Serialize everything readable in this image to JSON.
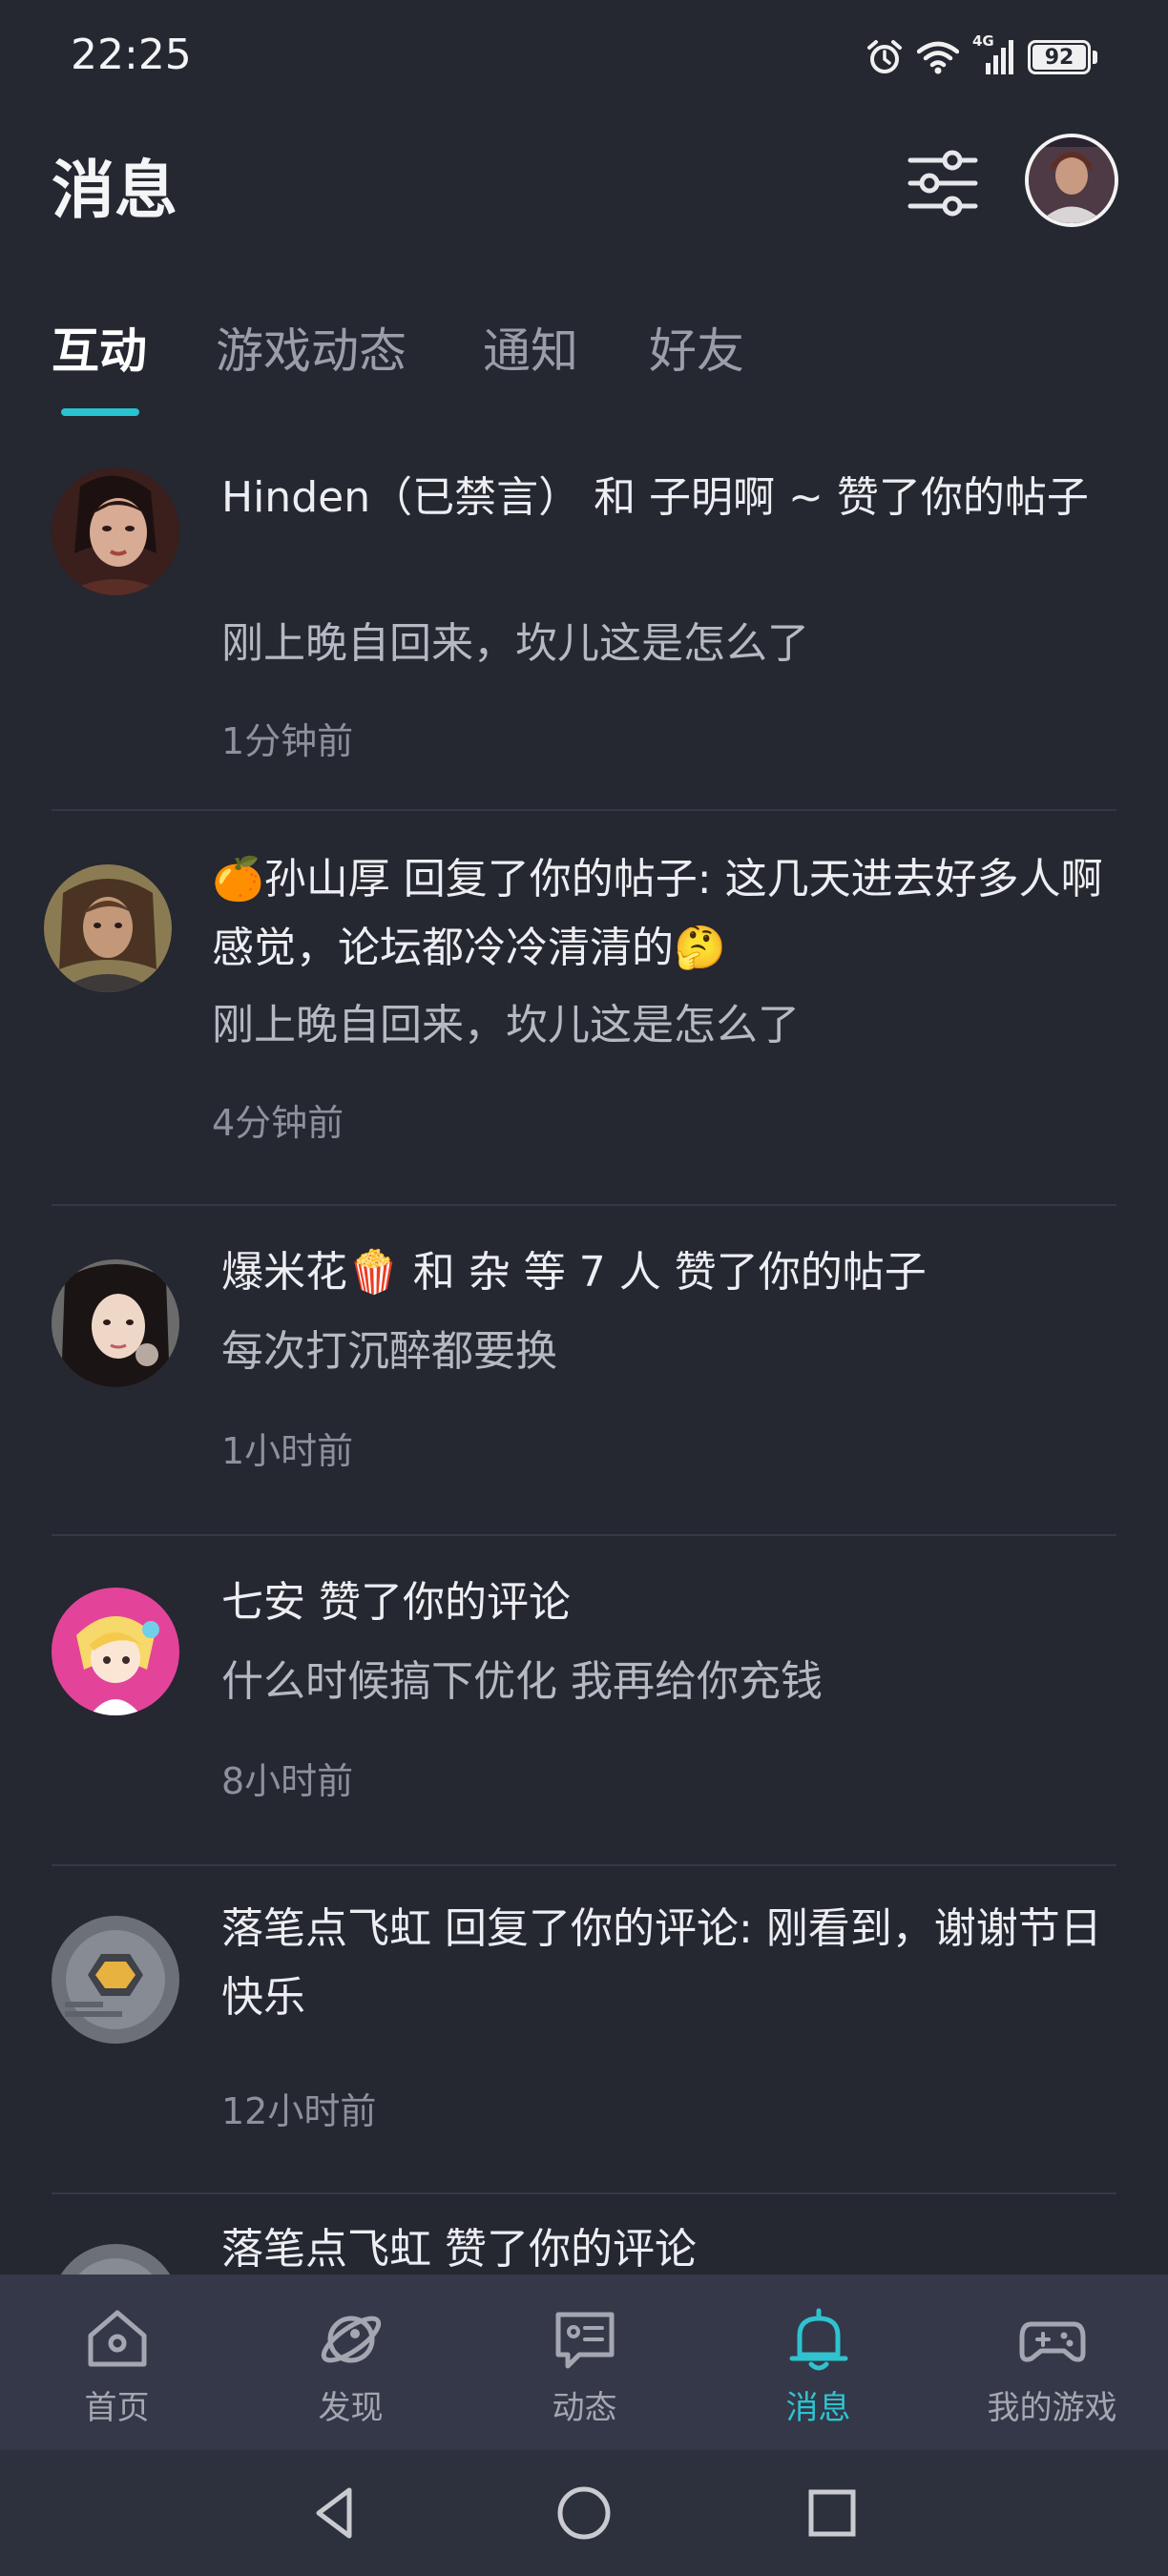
{
  "status_bar": {
    "time": "22:25",
    "battery": "92",
    "network": "4G"
  },
  "header": {
    "title": "消息"
  },
  "tabs": [
    {
      "label": "互动",
      "active": true
    },
    {
      "label": "游戏动态",
      "active": false
    },
    {
      "label": "通知",
      "active": false
    },
    {
      "label": "好友",
      "active": false
    }
  ],
  "items": [
    {
      "title": "Hinden（已禁言） 和 子明啊 ~ 赞了你的帖子",
      "excerpt": "刚上晚自回来，坎儿这是怎么了",
      "time": "1分钟前"
    },
    {
      "title": "🍊孙山厚 回复了你的帖子: 这几天进去好多人啊感觉，论坛都冷冷清清的🤔",
      "excerpt": "刚上晚自回来，坎儿这是怎么了",
      "time": "4分钟前"
    },
    {
      "title": "爆米花🍿 和 杂 等 7 人 赞了你的帖子",
      "excerpt": "每次打沉醉都要换",
      "time": "1小时前"
    },
    {
      "title": "七安 赞了你的评论",
      "excerpt": "什么时候搞下优化 我再给你充钱",
      "time": "8小时前"
    },
    {
      "title": "落笔点飞虹 回复了你的评论: 刚看到，谢谢节日快乐",
      "excerpt": "",
      "time": "12小时前"
    },
    {
      "title": "落笔点飞虹 赞了你的评论",
      "excerpt": "",
      "time": ""
    }
  ],
  "bottom_nav": [
    {
      "label": "首页",
      "icon": "home-icon",
      "active": false
    },
    {
      "label": "发现",
      "icon": "planet-icon",
      "active": false
    },
    {
      "label": "动态",
      "icon": "chat-card-icon",
      "active": false
    },
    {
      "label": "消息",
      "icon": "bell-icon",
      "active": true
    },
    {
      "label": "我的游戏",
      "icon": "gamepad-icon",
      "active": false
    }
  ],
  "colors": {
    "background": "#252731",
    "accent": "#27c3cf",
    "nav_background": "#353848"
  }
}
